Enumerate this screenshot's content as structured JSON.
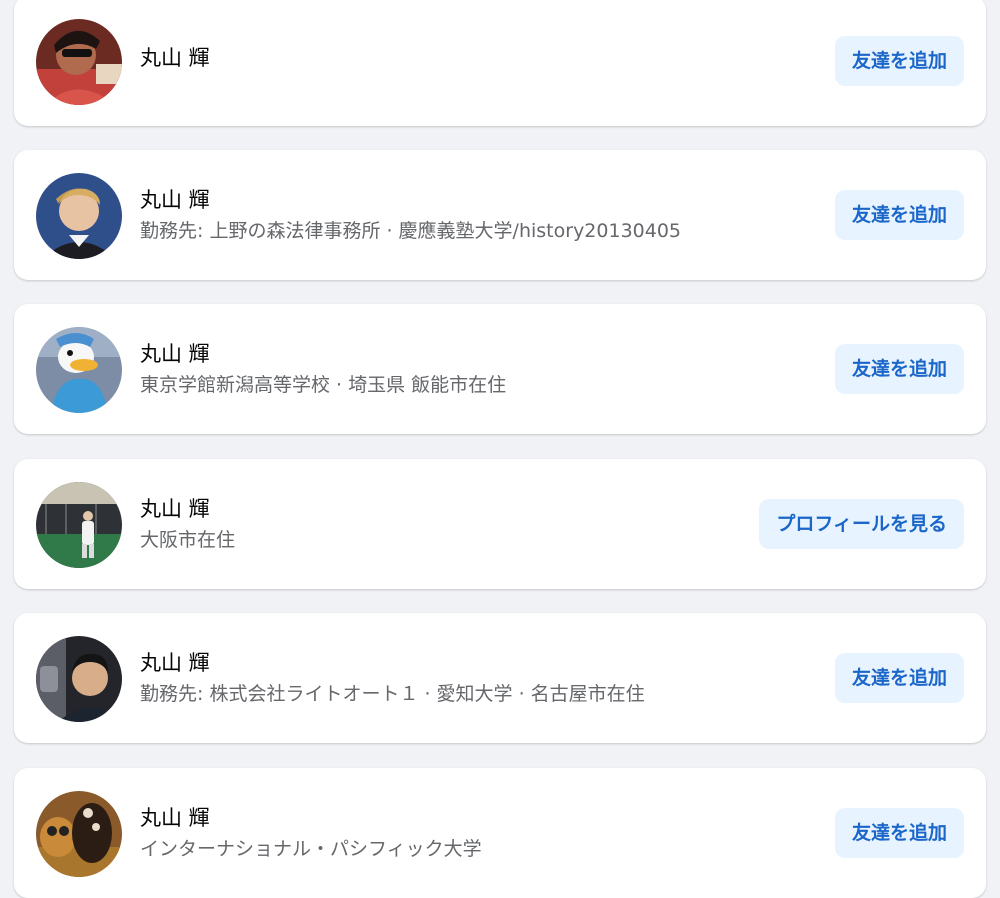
{
  "results": [
    {
      "name": "丸山 輝",
      "subtitle": "",
      "action": "友達を追加"
    },
    {
      "name": "丸山 輝",
      "subtitle": "勤務先: 上野の森法律事務所 · 慶應義塾大学/history20130405",
      "action": "友達を追加"
    },
    {
      "name": "丸山 輝",
      "subtitle": "東京学館新潟高等学校 · 埼玉県 飯能市在住",
      "action": "友達を追加"
    },
    {
      "name": "丸山 輝",
      "subtitle": "大阪市在住",
      "action": "プロフィールを見る"
    },
    {
      "name": "丸山 輝",
      "subtitle": "勤務先: 株式会社ライトオート１ · 愛知大学 · 名古屋市在住",
      "action": "友達を追加"
    },
    {
      "name": "丸山 輝",
      "subtitle": "インターナショナル・パシフィック大学",
      "action": "友達を追加"
    }
  ],
  "colors": {
    "background": "#f0f2f5",
    "card": "#ffffff",
    "button_bg": "#e7f3ff",
    "button_text": "#1b66c9",
    "name_text": "#050505",
    "sub_text": "#65676b"
  }
}
